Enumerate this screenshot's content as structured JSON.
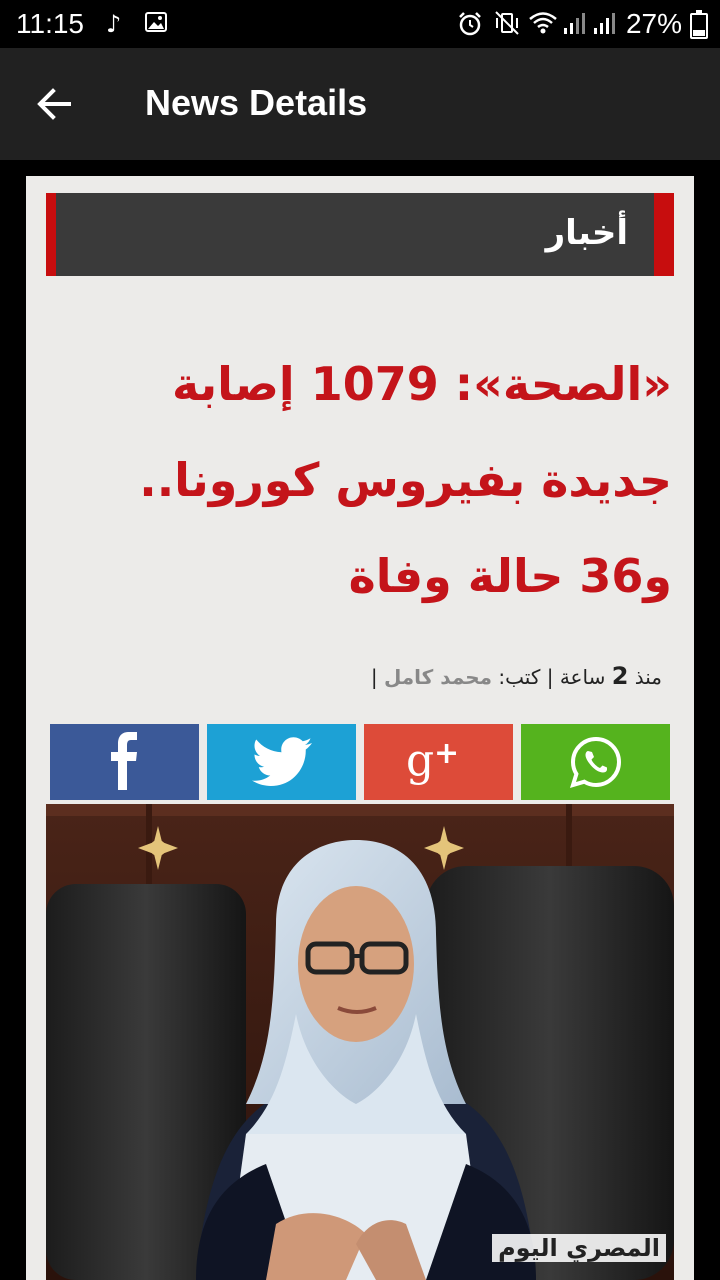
{
  "status_bar": {
    "time": "11:15",
    "battery": "27%",
    "battery_level": 0.27
  },
  "app_bar": {
    "title": "News Details"
  },
  "article": {
    "section": "أخبار",
    "headline": "«الصحة»: 1079 إصابة جديدة بفيروس كورونا.. و36 حالة وفاة",
    "meta": {
      "since": "منذ",
      "count": "2",
      "unit": "ساعة",
      "separator": "|",
      "by_label": "كتب:",
      "author": "محمد كامل"
    },
    "image_watermark": "المصري اليوم"
  },
  "share": {
    "facebook": "facebook-icon",
    "twitter": "twitter-icon",
    "google_plus": "google-plus-icon",
    "whatsapp": "whatsapp-icon"
  },
  "colors": {
    "accent": "#c70d0e",
    "headline": "#c4141a",
    "app_bar": "#212121",
    "facebook": "#3b5998",
    "twitter": "#1da1d5",
    "google_plus": "#dd4b39",
    "whatsapp": "#55b31e"
  }
}
